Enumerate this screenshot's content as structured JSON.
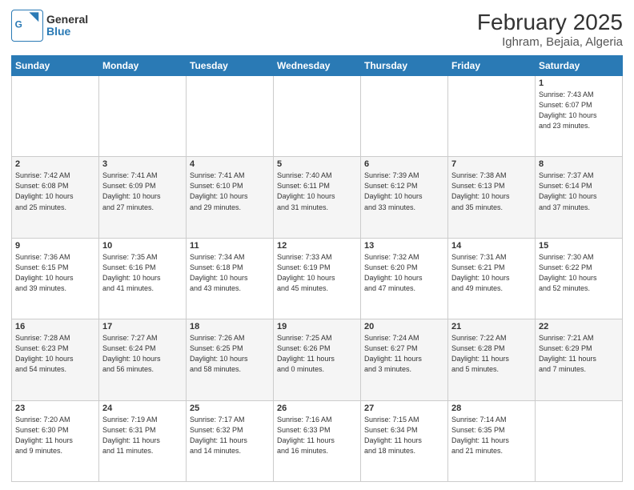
{
  "header": {
    "logo_general": "General",
    "logo_blue": "Blue",
    "title": "February 2025",
    "subtitle": "Ighram, Bejaia, Algeria"
  },
  "days_of_week": [
    "Sunday",
    "Monday",
    "Tuesday",
    "Wednesday",
    "Thursday",
    "Friday",
    "Saturday"
  ],
  "weeks": [
    [
      {
        "day": "",
        "info": ""
      },
      {
        "day": "",
        "info": ""
      },
      {
        "day": "",
        "info": ""
      },
      {
        "day": "",
        "info": ""
      },
      {
        "day": "",
        "info": ""
      },
      {
        "day": "",
        "info": ""
      },
      {
        "day": "1",
        "info": "Sunrise: 7:43 AM\nSunset: 6:07 PM\nDaylight: 10 hours\nand 23 minutes."
      }
    ],
    [
      {
        "day": "2",
        "info": "Sunrise: 7:42 AM\nSunset: 6:08 PM\nDaylight: 10 hours\nand 25 minutes."
      },
      {
        "day": "3",
        "info": "Sunrise: 7:41 AM\nSunset: 6:09 PM\nDaylight: 10 hours\nand 27 minutes."
      },
      {
        "day": "4",
        "info": "Sunrise: 7:41 AM\nSunset: 6:10 PM\nDaylight: 10 hours\nand 29 minutes."
      },
      {
        "day": "5",
        "info": "Sunrise: 7:40 AM\nSunset: 6:11 PM\nDaylight: 10 hours\nand 31 minutes."
      },
      {
        "day": "6",
        "info": "Sunrise: 7:39 AM\nSunset: 6:12 PM\nDaylight: 10 hours\nand 33 minutes."
      },
      {
        "day": "7",
        "info": "Sunrise: 7:38 AM\nSunset: 6:13 PM\nDaylight: 10 hours\nand 35 minutes."
      },
      {
        "day": "8",
        "info": "Sunrise: 7:37 AM\nSunset: 6:14 PM\nDaylight: 10 hours\nand 37 minutes."
      }
    ],
    [
      {
        "day": "9",
        "info": "Sunrise: 7:36 AM\nSunset: 6:15 PM\nDaylight: 10 hours\nand 39 minutes."
      },
      {
        "day": "10",
        "info": "Sunrise: 7:35 AM\nSunset: 6:16 PM\nDaylight: 10 hours\nand 41 minutes."
      },
      {
        "day": "11",
        "info": "Sunrise: 7:34 AM\nSunset: 6:18 PM\nDaylight: 10 hours\nand 43 minutes."
      },
      {
        "day": "12",
        "info": "Sunrise: 7:33 AM\nSunset: 6:19 PM\nDaylight: 10 hours\nand 45 minutes."
      },
      {
        "day": "13",
        "info": "Sunrise: 7:32 AM\nSunset: 6:20 PM\nDaylight: 10 hours\nand 47 minutes."
      },
      {
        "day": "14",
        "info": "Sunrise: 7:31 AM\nSunset: 6:21 PM\nDaylight: 10 hours\nand 49 minutes."
      },
      {
        "day": "15",
        "info": "Sunrise: 7:30 AM\nSunset: 6:22 PM\nDaylight: 10 hours\nand 52 minutes."
      }
    ],
    [
      {
        "day": "16",
        "info": "Sunrise: 7:28 AM\nSunset: 6:23 PM\nDaylight: 10 hours\nand 54 minutes."
      },
      {
        "day": "17",
        "info": "Sunrise: 7:27 AM\nSunset: 6:24 PM\nDaylight: 10 hours\nand 56 minutes."
      },
      {
        "day": "18",
        "info": "Sunrise: 7:26 AM\nSunset: 6:25 PM\nDaylight: 10 hours\nand 58 minutes."
      },
      {
        "day": "19",
        "info": "Sunrise: 7:25 AM\nSunset: 6:26 PM\nDaylight: 11 hours\nand 0 minutes."
      },
      {
        "day": "20",
        "info": "Sunrise: 7:24 AM\nSunset: 6:27 PM\nDaylight: 11 hours\nand 3 minutes."
      },
      {
        "day": "21",
        "info": "Sunrise: 7:22 AM\nSunset: 6:28 PM\nDaylight: 11 hours\nand 5 minutes."
      },
      {
        "day": "22",
        "info": "Sunrise: 7:21 AM\nSunset: 6:29 PM\nDaylight: 11 hours\nand 7 minutes."
      }
    ],
    [
      {
        "day": "23",
        "info": "Sunrise: 7:20 AM\nSunset: 6:30 PM\nDaylight: 11 hours\nand 9 minutes."
      },
      {
        "day": "24",
        "info": "Sunrise: 7:19 AM\nSunset: 6:31 PM\nDaylight: 11 hours\nand 11 minutes."
      },
      {
        "day": "25",
        "info": "Sunrise: 7:17 AM\nSunset: 6:32 PM\nDaylight: 11 hours\nand 14 minutes."
      },
      {
        "day": "26",
        "info": "Sunrise: 7:16 AM\nSunset: 6:33 PM\nDaylight: 11 hours\nand 16 minutes."
      },
      {
        "day": "27",
        "info": "Sunrise: 7:15 AM\nSunset: 6:34 PM\nDaylight: 11 hours\nand 18 minutes."
      },
      {
        "day": "28",
        "info": "Sunrise: 7:14 AM\nSunset: 6:35 PM\nDaylight: 11 hours\nand 21 minutes."
      },
      {
        "day": "",
        "info": ""
      }
    ]
  ]
}
